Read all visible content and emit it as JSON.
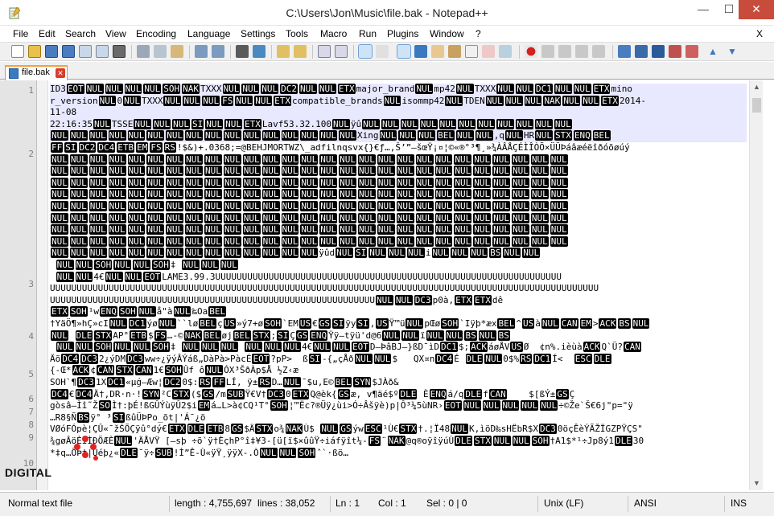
{
  "window": {
    "title": "C:\\Users\\Jon\\Music\\file.bak - Notepad++",
    "minimize_glyph": "—",
    "maximize_glyph": "☐",
    "close_glyph": "✕"
  },
  "menu": {
    "items": [
      "File",
      "Edit",
      "Search",
      "View",
      "Encoding",
      "Language",
      "Settings",
      "Tools",
      "Macro",
      "Run",
      "Plugins",
      "Window",
      "?"
    ],
    "close_doc": "X"
  },
  "tabs": [
    {
      "label": "file.bak",
      "close": "✕"
    }
  ],
  "editor": {
    "line_numbers": [
      "1",
      "2",
      "3",
      "4",
      "5",
      "6",
      "7",
      "8",
      "9",
      "10"
    ],
    "lines": [
      "ID3[EOT][NUL][NUL][NUL][NUL][SOH][NAK]TXXX[NUL][NUL][NUL][DC2][NUL][NUL][ETX]major_brand[NUL]mp42[NUL]TXXX[NUL][NUL][DC1][NUL][NUL][ETX]mino",
      "r_version[NUL]0[NUL]TXXX[NUL][NUL][NUL][FS][NUL][NUL][ETX]compatible_brands[NUL]isommp42[NUL]TDEN[NUL][NUL][NUL][NAK][NUL][NUL][ETX]2014-",
      "11-08",
      "22:16:35[NUL]TSSE[NUL][NUL][NUL][SI][NUL][NUL][ETX]Lavf53.32.100[NUL]ÿû[NUL][NUL][NUL][NUL][NUL][NUL][NUL][NUL][NUL][NUL][NUL]",
      "[NUL][NUL][NUL][NUL][NUL][NUL][NUL][NUL][NUL][NUL][NUL][NUL][NUL][NUL][NUL][NUL]Xing[NUL][NUL][NUL][BEL][NUL][NUL],q[NUL]HR[NUL][STX][ENQ][BEL]",
      "[FF][SI][DC2][DC4][ETB][EM][FS][RS]!$&)+.0368;=@BEHJMORTWZ\\_adfilnqsvx{}€ƒ…‚Š’”—šœŸ¡¤¦©«®°³¶¸»¾ÀÂÅÇÉÌÎÒÕ×ÜÜÞáâæéëîðóõøúý",
      "[NUL][NUL][NUL][NUL][NUL][NUL][NUL][NUL][NUL][NUL][NUL][NUL][NUL][NUL][NUL][NUL][NUL][NUL][NUL][NUL][NUL][NUL][NUL][NUL][NUL][NUL][NUL]",
      "[NUL][NUL][NUL][NUL][NUL][NUL][NUL][NUL][NUL][NUL][NUL][NUL][NUL][NUL][NUL][NUL][NUL][NUL][NUL][NUL][NUL][NUL][NUL][NUL][NUL][NUL][NUL]",
      "[NUL][NUL][NUL][NUL][NUL][NUL][NUL][NUL][NUL][NUL][NUL][NUL][NUL][NUL][NUL][NUL][NUL][NUL][NUL][NUL][NUL][NUL][NUL][NUL][NUL][NUL][NUL]",
      "[NUL][NUL][NUL][NUL][NUL][NUL][NUL][NUL][NUL][NUL][NUL][NUL][NUL][NUL][NUL][NUL][NUL][NUL][NUL][NUL][NUL][NUL][NUL][NUL][NUL][NUL][NUL]",
      "[NUL][NUL][NUL][NUL][NUL][NUL][NUL][NUL][NUL][NUL][NUL][NUL][NUL][NUL][NUL][NUL][NUL][NUL][NUL][NUL][NUL][NUL][NUL][NUL][NUL][NUL][NUL]",
      "[NUL][NUL][NUL][NUL][NUL][NUL][NUL][NUL][NUL][NUL][NUL][NUL][NUL][NUL][NUL][NUL][NUL][NUL][NUL][NUL][NUL][NUL][NUL][NUL][NUL][NUL][NUL]",
      "[NUL][NUL][NUL][NUL][NUL][NUL][NUL][NUL][NUL][NUL][NUL][NUL][NUL][NUL][NUL][NUL][NUL][NUL][NUL][NUL][NUL][NUL][NUL][NUL][NUL][NUL][NUL]",
      "[NUL][NUL][NUL][NUL][NUL][NUL][NUL][NUL][NUL][NUL][NUL][NUL][NUL][NUL][NUL][NUL][NUL][NUL][NUL][NUL][NUL][NUL][NUL][NUL][NUL][NUL][NUL]",
      "[NUL][NUL][NUL][NUL][NUL][NUL][NUL][NUL][NUL][NUL][NUL][NUL][NUL][NUL]ÿûd[NUL][SI][NUL][NUL][NUL]i[NUL][NUL][NUL][BS][NUL][NUL]",
      " [NUL][NUL][SOH][NUL][NUL][SOH]‡ [NUL][NUL][NUL]",
      " [NUL][NUL]4€[NUL][NUL][EOT]LAME3.99.3UUUUUUUUUUUUUUUUUUUUUUUUUUUUUUUUUUUUUUUUUUUUUUUUUUUUUUUUUUUUUUUUU",
      "UUUUUUUUUUUUUUUUUUUUUUUUUUUUUUUUUUUUUUUUUUUUUUUUUUUUUUUUUUUUUUUUUUUUUUUUUUUUUUUUUUUUUUUUUUUUUUUUUUUUUUU",
      "UUUUUUUUUUUUUUUUUUUUUUUUUUUUUUUUUUUUUUUUUUUUUUUUUUUUUUUUUUUUU[NUL][NUL][DC3]p0à,[ETX][ETX]dê",
      "[ETX][SOH]¹w[ENQ][SOH][NUL]å\"à[NUL]‰Oa[BEL]",
      "†YäÖ¶»hÇ»cI[NUL][DC1]ýø[NUL]``lø[BEL]ç[US]»ý7+ø[SOH]`EM[US]€[GS][SI]ÿy[SI],[US]Ÿ™ü[NUL]pŒø[SOH]`Iÿþ*æx[BEL]^[US]à[NUL][CAN][EM]>[ACK][BS][NUL]",
      "[NUL] [DLE][STX]AP°[ETB]$[FS]…-©[NAK][BEL]øj[BEL][STX];[SI]Ç[GS][ENQ]Ÿÿ–tÿü'd@6[NUL][NUL]ï[NUL][NUL][BS][NUL][BS]",
      " [NUL][NUL][SOH][NUL][NUL][SOH]‡ [NUL][NUL][NUL] [NUL][NUL][NUL]4€[NUL][NUL][EOT]D–ÞâBJ–}ßD¯ìD[DC1]$;[ACK]áøÅV[US]Ø  ¢n%.ièùà[ACK]Q`Ü?[CAN]",
      "Äõ[DC4][DC3]2¿ýDM[DC3]ww÷¿ÿýÂÝáß„DàPà>PàcÉ[EOT]?pP>  ß[SI]-{„çÅð[NUL][NUL]$   QX¤n[DC4]É [DLE][NUL]0$%[RS][DC1]Í<  [ESC][DLE]",
      "{-Œ*[ACK]¢[CAN][STX][CAN]1€[SOH]Ûf ô[NUL]ÓX³ŠðÀp$Å ½Z‹æ",
      "SOH`¶[DC3]1X[DC1]«µǵ–Æw¦[DC2]0$:[RS][FF]LÍ, ÿ±[RS]D…[NUL]¯$u,E©[BEL][SYN]$JÀð&",
      "[DC4]€[DC4]Ä†,DR·n·![SYN]²C[STX]($[GS]/m[SUB]Ÿ€V†[DC3]0[ETX]Q@èk{[GS]æ, v¶äé$º[DLE] È[ENQ]á/q[DLE]f[CAN]    $[ßÝ±[GS]Ç",
      "gòsâ—Ìî˜Ž[SO]Ì†:þÉ!ßGÛÝùÿÛ2$i[EM]á…L>à¢CQ¹T°[SOH]¦™Ëc?®Üÿ¿ùi>Ó÷Âšÿè)p|Ô³¼5ùNR›[EOT][NUL][NUL][NUL][NUL][NUL]÷©Že`Š€6j\"p=\"ÿ",
      "…R8§Ñ[BS]ÿ° ³[SI]ßûÜÞPo_õt|'Á¯¿ö",
      "VØóFÓpè¦ÇÛ«¯žŠÕÇÿû°dý€[ETX][DLE][ETB]8[GS]$Ä[STX]o¾[NAK]Ù$ [NUL][GS]ýw[ESC]¹Ù€[STX]†.¦Ï48[NUL]K,ìöD‰sHËbR$X[DC3]0öçÊèÝÃŽÏGZPŸÇS\"",
      "¾gøÂöÈÍÌÐÖÆÈ[NUL]'ÄÅVŸ [–sþ ÷õ`ÿ†ÈçhP°î‡¥3-[ü[ï$×ûûŸ÷iáfÿît¼-[FS]¨[NAK]@q®oÿîÿúÙ[DLE][STX][NUL][NUL][SOH]†A1$*¹÷Jp8ý1[DLE]30",
      "*‡q…ÕÞ‡|Ûéþ¿«[DLE]¯ÿ÷[SUB]!Ì”Ê-Ù«ÿŸ¸ÿÿX-.Ò[NUL][NUL][SOH]ˆ`·ßö…"
    ],
    "line_starts": [
      0,
      4,
      5,
      15,
      16,
      19,
      20,
      22,
      23,
      24,
      27,
      28,
      30
    ]
  },
  "watermark": {
    "text": "DIGITAL"
  },
  "status": {
    "doc_type": "Normal text file",
    "length": "length : 4,755,697",
    "lines": "lines : 38,052",
    "ln": "Ln : 1",
    "col": "Col : 1",
    "sel": "Sel : 0 | 0",
    "eol": "Unix (LF)",
    "encoding": "ANSI",
    "mode": "INS"
  },
  "colors": {
    "tab_accent": "#f7a034",
    "current_line": "#e8e8ff",
    "control_char_bg": "#000000",
    "close_button": "#c74c3c"
  }
}
